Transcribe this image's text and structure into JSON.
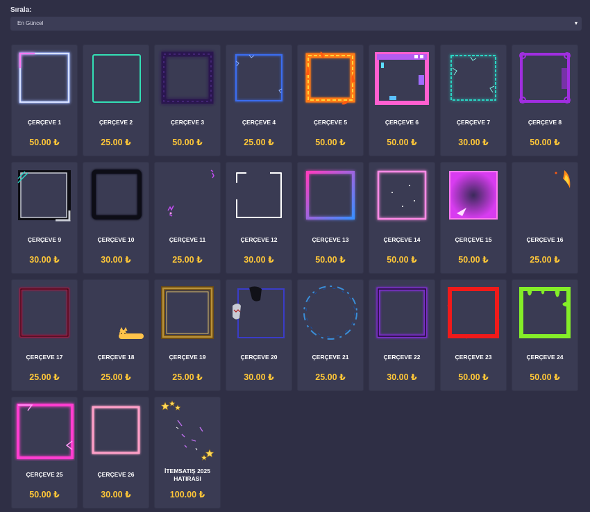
{
  "sort": {
    "label": "Sırala:",
    "value": "En Güncel",
    "caret_icon": "caret-down-icon"
  },
  "currency_symbol": "₺",
  "items": [
    {
      "name": "ÇERÇEVE 1",
      "price": "50.00 ₺",
      "frame": "neon-blue-white",
      "color": "#9ab2ff"
    },
    {
      "name": "ÇERÇEVE 2",
      "price": "25.00 ₺",
      "frame": "thin-mint",
      "color": "#33e0b5"
    },
    {
      "name": "ÇERÇEVE 3",
      "price": "50.00 ₺",
      "frame": "smoky-purple",
      "color": "#2a1450"
    },
    {
      "name": "ÇERÇEVE 4",
      "price": "25.00 ₺",
      "frame": "electric-blue",
      "color": "#3a6df0"
    },
    {
      "name": "ÇERÇEVE 5",
      "price": "50.00 ₺",
      "frame": "fire",
      "color": "#ff7a18"
    },
    {
      "name": "ÇERÇEVE 6",
      "price": "50.00 ₺",
      "frame": "retro-window",
      "color": "#ff5fd0"
    },
    {
      "name": "ÇERÇEVE 7",
      "price": "30.00 ₺",
      "frame": "teal-lightning",
      "color": "#2ad6c4"
    },
    {
      "name": "ÇERÇEVE 8",
      "price": "50.00 ₺",
      "frame": "purple-tech",
      "color": "#a02ee0"
    },
    {
      "name": "ÇERÇEVE 9",
      "price": "30.00 ₺",
      "frame": "dark-tech",
      "color": "#c8cbd4"
    },
    {
      "name": "ÇERÇEVE 10",
      "price": "30.00 ₺",
      "frame": "black-smoke",
      "color": "#0c0c12"
    },
    {
      "name": "ÇERÇEVE 11",
      "price": "25.00 ₺",
      "frame": "sparks",
      "color": "#c04cf0"
    },
    {
      "name": "ÇERÇEVE 12",
      "price": "30.00 ₺",
      "frame": "white-corners",
      "color": "#ffffff"
    },
    {
      "name": "ÇERÇEVE 13",
      "price": "50.00 ₺",
      "frame": "neon-gradient",
      "color": "#ff3cbe"
    },
    {
      "name": "ÇERÇEVE 14",
      "price": "50.00 ₺",
      "frame": "pink-lightning",
      "color": "#ff8ae6"
    },
    {
      "name": "ÇERÇEVE 15",
      "price": "50.00 ₺",
      "frame": "magenta-glow",
      "color": "#d83cf0"
    },
    {
      "name": "ÇERÇEVE 16",
      "price": "25.00 ₺",
      "frame": "fire-corner",
      "color": "#ff8a18"
    },
    {
      "name": "ÇERÇEVE 17",
      "price": "25.00 ₺",
      "frame": "red-neon",
      "color": "#b01840"
    },
    {
      "name": "ÇERÇEVE 18",
      "price": "25.00 ₺",
      "frame": "cat",
      "color": "#ffc34a"
    },
    {
      "name": "ÇERÇEVE 19",
      "price": "25.00 ₺",
      "frame": "gold",
      "color": "#b8913a"
    },
    {
      "name": "ÇERÇEVE 20",
      "price": "30.00 ₺",
      "frame": "shark",
      "color": "#3a3cc8"
    },
    {
      "name": "ÇERÇEVE 21",
      "price": "25.00 ₺",
      "frame": "blue-circle",
      "color": "#3a8ed8"
    },
    {
      "name": "ÇERÇEVE 22",
      "price": "30.00 ₺",
      "frame": "purple-smoke",
      "color": "#7a2ec8"
    },
    {
      "name": "ÇERÇEVE 23",
      "price": "50.00 ₺",
      "frame": "red-paint",
      "color": "#f01a1a"
    },
    {
      "name": "ÇERÇEVE 24",
      "price": "50.00 ₺",
      "frame": "green-slime",
      "color": "#84ee28"
    },
    {
      "name": "ÇERÇEVE 25",
      "price": "50.00 ₺",
      "frame": "pink-electric",
      "color": "#ff3cd0"
    },
    {
      "name": "ÇERÇEVE 26",
      "price": "30.00 ₺",
      "frame": "pink-soft",
      "color": "#ffa0c8"
    },
    {
      "name": "İTEMSATIŞ 2025 HATIRASI",
      "price": "100.00 ₺",
      "frame": "stars",
      "color": "#ffd95a"
    }
  ]
}
